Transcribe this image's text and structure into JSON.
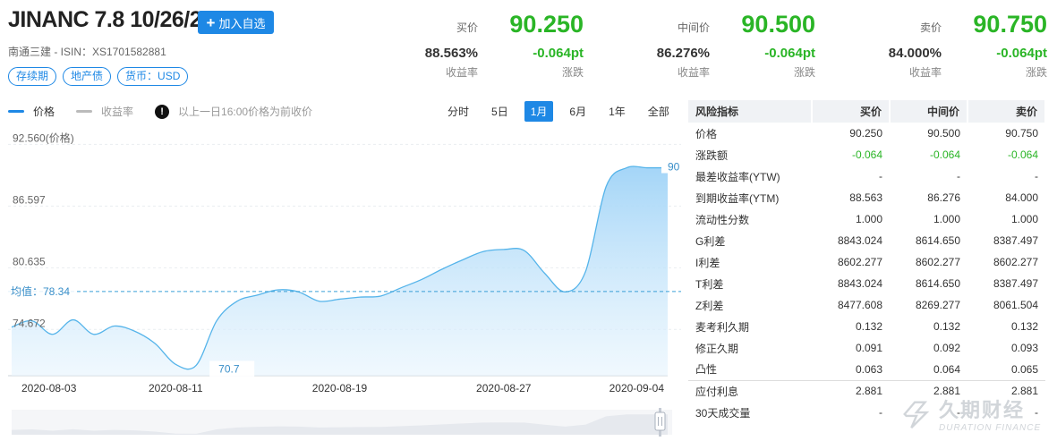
{
  "header": {
    "title": "JINANC 7.8 10/26/20",
    "add_button": "加入自选",
    "subtitle": "南通三建 - ISIN：XS1701582881",
    "tags": [
      "存续期",
      "地产债",
      "货币：USD"
    ]
  },
  "quotes": [
    {
      "label": "买价",
      "price": "90.250",
      "yield": "88.563%",
      "yield_label": "收益率",
      "change": "-0.064pt",
      "change_label": "涨跌"
    },
    {
      "label": "中间价",
      "price": "90.500",
      "yield": "86.276%",
      "yield_label": "收益率",
      "change": "-0.064pt",
      "change_label": "涨跌"
    },
    {
      "label": "卖价",
      "price": "90.750",
      "yield": "84.000%",
      "yield_label": "收益率",
      "change": "-0.064pt",
      "change_label": "涨跌"
    }
  ],
  "legend": {
    "price": "价格",
    "yield": "收益率",
    "info_icon": "!",
    "note": "以上一日16:00价格为前收价",
    "price_color": "#1e88e5",
    "yield_color": "#bbbbbb"
  },
  "ranges": [
    "分时",
    "5日",
    "1月",
    "6月",
    "1年",
    "全部"
  ],
  "active_range": "1月",
  "chart_data": {
    "type": "area",
    "title": "",
    "ylabel": "",
    "y_ticks": [
      "92.560(价格)",
      "86.597",
      "80.635",
      "74.672"
    ],
    "ylim": [
      70.2,
      93.2
    ],
    "x_tick_labels": [
      "2020-08-03",
      "2020-08-11",
      "2020-08-19",
      "2020-08-27",
      "2020-09-04"
    ],
    "avg_label": "均值：78.34",
    "avg_value": 78.34,
    "min_label": "70.7",
    "last_label": "90",
    "series": [
      {
        "values": [
          74.9,
          75.5,
          74.2,
          75.6,
          74.2,
          75.0,
          74.5,
          73.3,
          71.3,
          71.2,
          75.5,
          77.4,
          78.0,
          78.5,
          78.3,
          77.4,
          77.6,
          77.8,
          77.9,
          78.7,
          79.5,
          80.5,
          81.4,
          82.2,
          82.4,
          82.3,
          80.1,
          78.3,
          80.3,
          88.5,
          90.3,
          90.3,
          90.3
        ],
        "color": "#1e88e5"
      }
    ]
  },
  "risk_table": {
    "headers": [
      "风险指标",
      "买价",
      "中间价",
      "卖价"
    ],
    "rows": [
      {
        "name": "价格",
        "values": [
          "90.250",
          "90.500",
          "90.750"
        ]
      },
      {
        "name": "涨跌额",
        "values": [
          "-0.064",
          "-0.064",
          "-0.064"
        ],
        "green": true
      },
      {
        "name": "最差收益率(YTW)",
        "values": [
          "-",
          "-",
          "-"
        ]
      },
      {
        "name": "到期收益率(YTM)",
        "values": [
          "88.563",
          "86.276",
          "84.000"
        ]
      },
      {
        "name": "流动性分数",
        "values": [
          "1.000",
          "1.000",
          "1.000"
        ]
      },
      {
        "name": "G利差",
        "values": [
          "8843.024",
          "8614.650",
          "8387.497"
        ]
      },
      {
        "name": "I利差",
        "values": [
          "8602.277",
          "8602.277",
          "8602.277"
        ]
      },
      {
        "name": "T利差",
        "values": [
          "8843.024",
          "8614.650",
          "8387.497"
        ]
      },
      {
        "name": "Z利差",
        "values": [
          "8477.608",
          "8269.277",
          "8061.504"
        ]
      },
      {
        "name": "麦考利久期",
        "values": [
          "0.132",
          "0.132",
          "0.132"
        ]
      },
      {
        "name": "修正久期",
        "values": [
          "0.091",
          "0.092",
          "0.093"
        ]
      },
      {
        "name": "凸性",
        "values": [
          "0.063",
          "0.064",
          "0.065"
        ]
      },
      {
        "name": "应付利息",
        "values": [
          "2.881",
          "2.881",
          "2.881"
        ],
        "sep": true
      },
      {
        "name": "30天成交量",
        "values": [
          "-",
          "-",
          "-"
        ]
      }
    ]
  },
  "watermark": {
    "cn": "久期财经",
    "en": "DURATION FINANCE"
  }
}
